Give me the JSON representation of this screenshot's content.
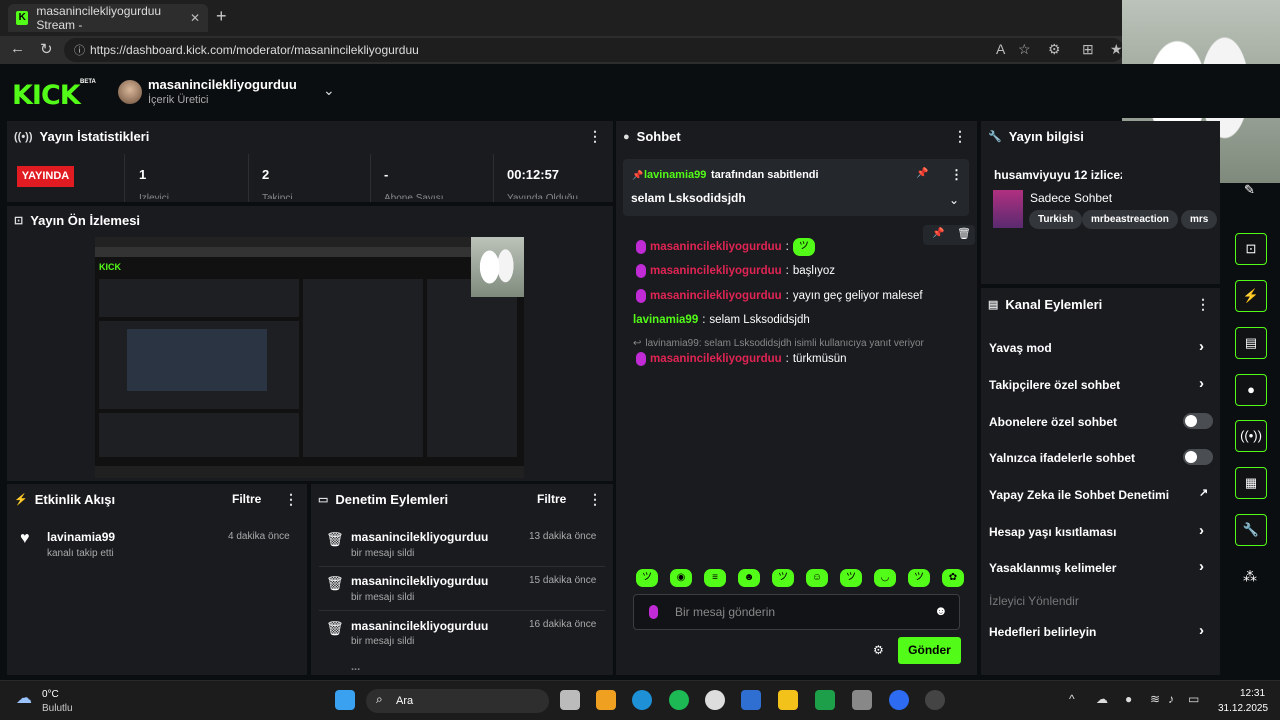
{
  "browser": {
    "tab_title": "masanincilekliyogurduu Stream -",
    "tab_close": "✕",
    "new_tab": "+",
    "url": "https://dashboard.kick.com/moderator/masanincilekliyogurduu"
  },
  "header": {
    "logo": "KICK",
    "beta": "BETA",
    "username": "masanincilekliyogurduu",
    "role": "İçerik Üretici"
  },
  "stats": {
    "title": "Yayın İstatistikleri",
    "live_badge": "YAYINDA",
    "values": [
      "1",
      "2",
      "-",
      "00:12:57"
    ],
    "labels": [
      "İzleyici",
      "Takipçi",
      "Abone Sayısı",
      "Yayında Olduğu"
    ]
  },
  "preview": {
    "title": "Yayın Ön İzlemesi"
  },
  "activity": {
    "title": "Etkinlik Akışı",
    "filter": "Filtre",
    "items": [
      {
        "user": "lavinamia99",
        "action": "kanalı takip etti",
        "time": "4 dakika önce"
      }
    ]
  },
  "moderation": {
    "title": "Denetim Eylemleri",
    "filter": "Filtre",
    "items": [
      {
        "user": "masanincilekliyogurduu",
        "action": "bir mesajı sildi",
        "time": "13 dakika önce"
      },
      {
        "user": "masanincilekliyogurduu",
        "action": "bir mesajı sildi",
        "time": "15 dakika önce"
      },
      {
        "user": "masanincilekliyogurduu",
        "action": "bir mesajı sildi",
        "time": "16 dakika önce"
      }
    ]
  },
  "chat": {
    "title": "Sohbet",
    "pinned_by_user": "lavinamia99",
    "pinned_by_text": "tarafından sabitlendi",
    "pinned_message": "selam Lsksodidsjdh",
    "messages": [
      {
        "user": "masanincilekliyogurduu",
        "text": ""
      },
      {
        "user": "masanincilekliyogurduu",
        "text": "başlıyoz"
      },
      {
        "user": "masanincilekliyogurduu",
        "text": "yayın geç geliyor malesef"
      },
      {
        "user": "lavinamia99",
        "text": "selam Lsksodidsjdh"
      },
      {
        "user": "masanincilekliyogurduu",
        "text": "türkmüsün"
      }
    ],
    "reply_notice": "lavinamia99: selam Lsksodidsjdh isimli kullanıcıya yanıt veriyor",
    "input_placeholder": "Bir mesaj gönderin",
    "send": "Gönder"
  },
  "stream_info": {
    "title": "Yayın bilgisi",
    "stream_title": "husamviyuyu 12 izlicez",
    "category": "Sadece Sohbet",
    "tags": [
      "Turkish",
      "mrbeastreaction",
      "mrs"
    ]
  },
  "channel_actions": {
    "title": "Kanal Eylemleri",
    "items": [
      {
        "label": "Yavaş mod",
        "control": "arrow"
      },
      {
        "label": "Takipçilere özel sohbet",
        "control": "arrow"
      },
      {
        "label": "Abonelere özel sohbet",
        "control": "toggle"
      },
      {
        "label": "Yalnızca ifadelerle sohbet",
        "control": "toggle"
      },
      {
        "label": "Yapay Zeka ile Sohbet Denetimi",
        "control": "external"
      },
      {
        "label": "Hesap yaşı kısıtlaması",
        "control": "arrow"
      },
      {
        "label": "Yasaklanmış kelimeler",
        "control": "arrow"
      }
    ],
    "section_label": "İzleyici Yönlendir",
    "goals": "Hedefleri belirleyin"
  },
  "taskbar": {
    "weather_temp": "0°C",
    "weather_desc": "Bulutlu",
    "search": "Ara",
    "time": "12:31",
    "date": "31.12.2025"
  },
  "colors": {
    "accent": "#53fc18",
    "live": "#e01c22",
    "username_pink": "#e02453",
    "panel": "#191b1f"
  }
}
